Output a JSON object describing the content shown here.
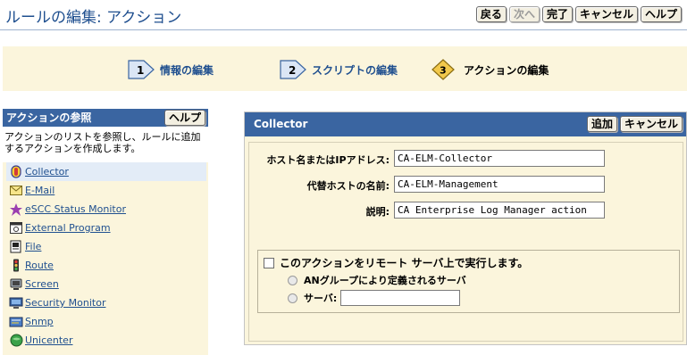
{
  "page": {
    "title": "ルールの編集: アクション",
    "buttons": [
      "戻る",
      "次へ",
      "完了",
      "キャンセル",
      "ヘルプ"
    ]
  },
  "wizard": {
    "steps": [
      {
        "num": "1",
        "label": "情報の編集"
      },
      {
        "num": "2",
        "label": "スクリプトの編集"
      },
      {
        "num": "3",
        "label": "アクションの編集"
      }
    ]
  },
  "left_panel": {
    "title": "アクションの参照",
    "help_button": "ヘルプ",
    "description": "アクションのリストを参照し、ルールに追加するアクションを作成します。",
    "items": [
      {
        "label": "Collector",
        "icon": "collector-icon"
      },
      {
        "label": "E-Mail",
        "icon": "email-icon"
      },
      {
        "label": "eSCC Status Monitor",
        "icon": "status-monitor-icon"
      },
      {
        "label": "External Program",
        "icon": "external-program-icon"
      },
      {
        "label": "File",
        "icon": "file-icon"
      },
      {
        "label": "Route",
        "icon": "route-icon"
      },
      {
        "label": "Screen",
        "icon": "screen-icon"
      },
      {
        "label": "Security Monitor",
        "icon": "security-monitor-icon"
      },
      {
        "label": "Snmp",
        "icon": "snmp-icon"
      },
      {
        "label": "Unicenter",
        "icon": "unicenter-icon"
      }
    ]
  },
  "right_panel": {
    "title": "Collector",
    "add_button": "追加",
    "cancel_button": "キャンセル",
    "fields": {
      "host_label": "ホスト名またはIPアドレス:",
      "host_value": "CA-ELM-Collector",
      "alt_host_label": "代替ホストの名前:",
      "alt_host_value": "CA-ELM-Management",
      "desc_label": "説明:",
      "desc_value": "CA Enterprise Log Manager action"
    },
    "remote": {
      "checkbox_label": "このアクションをリモート サーバ上で実行します。",
      "radio_group_label": "ANグループにより定義されるサーバ",
      "radio_server_label": "サーバ:"
    }
  },
  "colors": {
    "header_blue": "#3a65a1",
    "panel_bg": "#fbf5dc",
    "link_blue": "#1f4f8f"
  }
}
